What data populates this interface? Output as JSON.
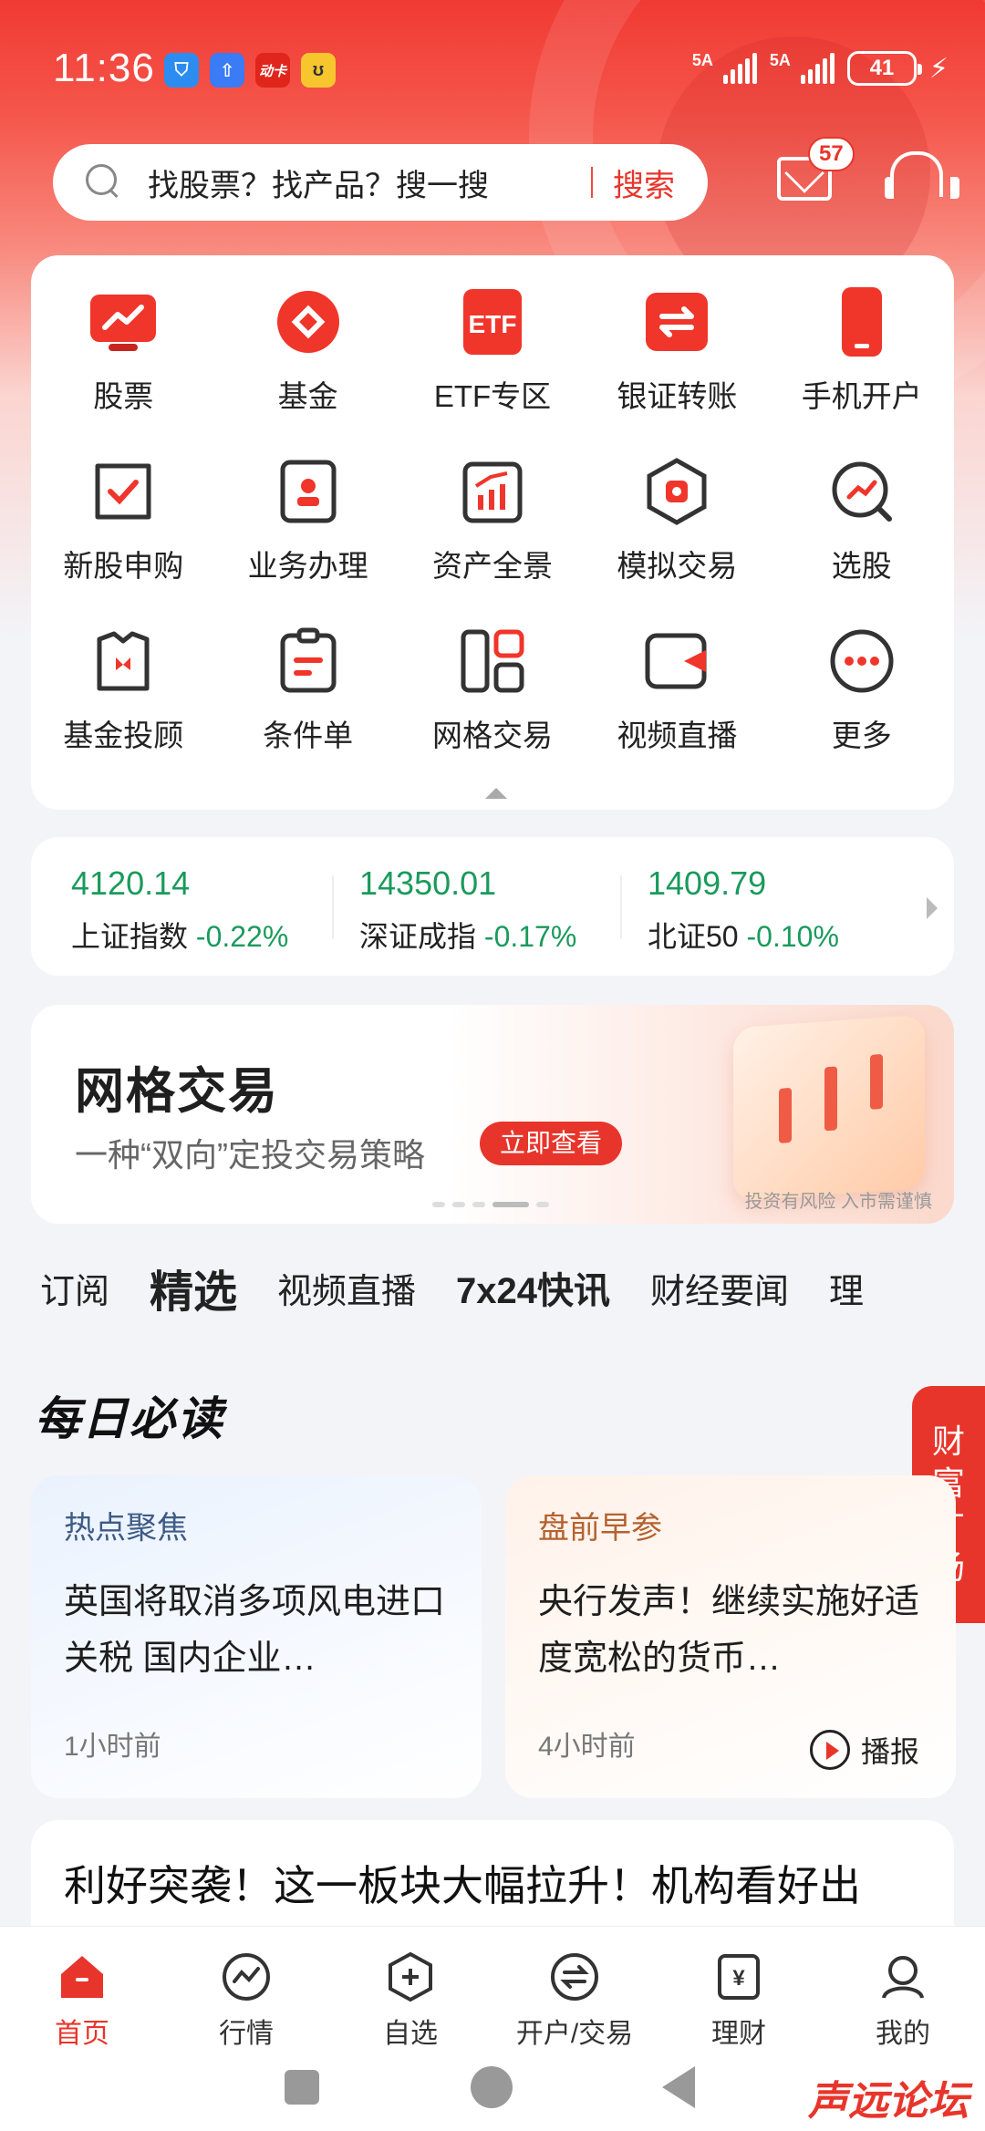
{
  "status_bar": {
    "time": "11:36",
    "app_badge_text": "动卡",
    "signal1": "5A",
    "signal2": "5A",
    "battery": "41"
  },
  "search": {
    "placeholder": "找股票？找产品？搜一搜",
    "button": "搜索",
    "mail_badge": "57"
  },
  "functions": {
    "row1": [
      {
        "label": "股票",
        "icon": "stock-chart-icon"
      },
      {
        "label": "基金",
        "icon": "fund-icon"
      },
      {
        "label": "ETF专区",
        "icon": "etf-icon",
        "text": "ETF"
      },
      {
        "label": "银证转账",
        "icon": "transfer-icon"
      },
      {
        "label": "手机开户",
        "icon": "phone-account-icon"
      }
    ],
    "row2": [
      {
        "label": "新股申购",
        "icon": "ipo-subscribe-icon"
      },
      {
        "label": "业务办理",
        "icon": "business-icon"
      },
      {
        "label": "资产全景",
        "icon": "asset-overview-icon"
      },
      {
        "label": "模拟交易",
        "icon": "simulated-trade-icon"
      },
      {
        "label": "选股",
        "icon": "stock-picker-icon"
      }
    ],
    "row3": [
      {
        "label": "基金投顾",
        "icon": "fund-advisor-icon"
      },
      {
        "label": "条件单",
        "icon": "condition-order-icon"
      },
      {
        "label": "网格交易",
        "icon": "grid-trade-icon"
      },
      {
        "label": "视频直播",
        "icon": "video-live-icon"
      },
      {
        "label": "更多",
        "icon": "more-icon"
      }
    ]
  },
  "indices": [
    {
      "value": "4120.14",
      "name": "上证指数",
      "change": "-0.22%"
    },
    {
      "value": "14350.01",
      "name": "深证成指",
      "change": "-0.17%"
    },
    {
      "value": "1409.79",
      "name": "北证50",
      "change": "-0.10%"
    }
  ],
  "banner": {
    "title": "网格交易",
    "subtitle": "一种“双向”定投交易策略",
    "cta": "立即查看",
    "risk": "投资有风险 入市需谨慎"
  },
  "tabs": [
    "订阅",
    "精选",
    "视频直播",
    "7x24快讯",
    "财经要闻",
    "理"
  ],
  "daily": {
    "heading": "每日必读",
    "side_tag": [
      "财",
      "富",
      "广",
      "场"
    ],
    "cards": [
      {
        "category": "热点聚焦",
        "title": "英国将取消多项风电进口关税 国内企业…",
        "ago": "1小时前"
      },
      {
        "category": "盘前早参",
        "title": "央行发声！继续实施好适度宽松的货币…",
        "ago": "4小时前",
        "play": "播报"
      }
    ],
    "headline": "利好突袭！这一板块大幅拉升！机构看好出"
  },
  "bottom_nav": [
    "首页",
    "行情",
    "自选",
    "开户/交易",
    "理财",
    "我的"
  ],
  "watermark": "声远论坛",
  "colors": {
    "accent": "#e8352b",
    "down": "#1a9a5c"
  }
}
